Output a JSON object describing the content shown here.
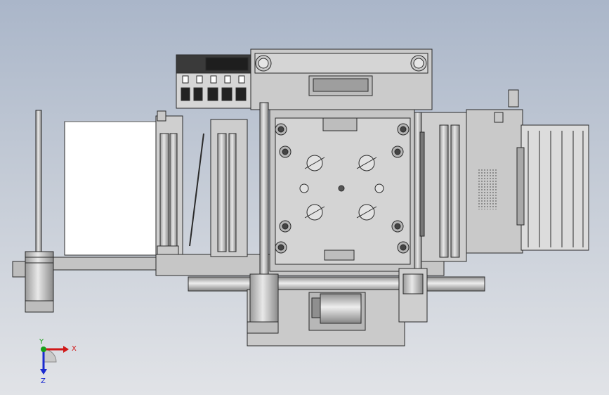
{
  "viewport": {
    "background_top": "#aab6c9",
    "background_bottom": "#e1e3e7",
    "model_fill": "#c9c9c9",
    "model_stroke": "#2a2a2a",
    "sheet_fill": "#ffffff"
  },
  "triad": {
    "x_label": "X",
    "y_label": "Y",
    "z_label": "Z",
    "x_color": "#d01818",
    "y_color": "#18a018",
    "z_color": "#1a2ad0"
  },
  "model": {
    "name": "machine-assembly-top-view",
    "icons": [
      "bolt-icon",
      "motor-icon",
      "roller-icon",
      "control-panel-icon"
    ]
  }
}
